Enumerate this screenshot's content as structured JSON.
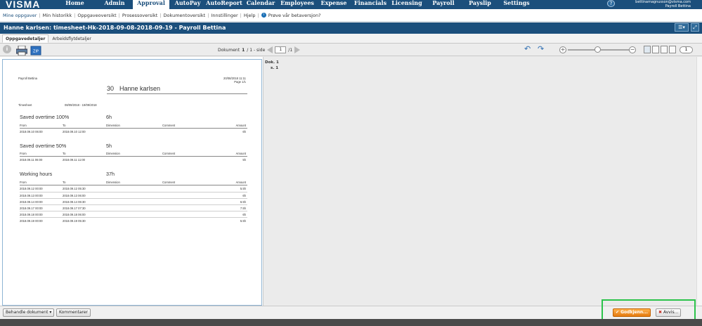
{
  "brand": {
    "logo_text": "VISMA"
  },
  "nav": {
    "items": [
      {
        "label": "Home"
      },
      {
        "label": "Admin"
      },
      {
        "label": "Approval"
      },
      {
        "label": "AutoPay"
      },
      {
        "label": "AutoReport"
      },
      {
        "label": "Calendar"
      },
      {
        "label": "Employees"
      },
      {
        "label": "Expense"
      },
      {
        "label": "Financials"
      },
      {
        "label": "Licensing"
      },
      {
        "label": "Payroll"
      },
      {
        "label": "Payslip"
      },
      {
        "label": "Settings"
      }
    ],
    "active": "Approval"
  },
  "account": {
    "email": "bettinamagnusson@visma.com",
    "company": "Payroll Bettina"
  },
  "subnav": {
    "items": [
      "Mine oppgaver",
      "Min historikk",
      "Oppgaveoversikt",
      "Prosessoversikt",
      "Dokumentoversikt",
      "Innstillinger",
      "Hjelp"
    ],
    "beta_link": "Prøve vår betaversjon?"
  },
  "page_title": "Hanne karlsen: timesheet-Hk-2018-09-08-2018-09-19 - Payroll Bettina",
  "tabs": [
    "Oppgavedetaljer",
    "Arbeidsflytdetaljer"
  ],
  "toolbar": {
    "doc_label": "Dokument",
    "doc_num": "1",
    "doc_of": "/ 1 - side",
    "page_input": "1",
    "page_total": "/1",
    "page_count_badge": "1"
  },
  "document": {
    "company": "Payroll Bettina",
    "print_date": "20/08/2018 11:11",
    "page_info": "Page 1/1",
    "emp_number": "30",
    "emp_name": "Hanne karlsen",
    "doc_type": "Timesheet",
    "period": "08/09/2018 - 19/09/2018",
    "col_from": "From",
    "col_to": "To",
    "col_dimension": "Dimension",
    "col_comment": "Comment",
    "col_amount": "Amount",
    "sections": [
      {
        "title": "Saved overtime 100%",
        "total": "6h",
        "rows": [
          {
            "from": "2018.09.10 06:00",
            "to": "2018.09.10 12:00",
            "amount": "6h"
          }
        ]
      },
      {
        "title": "Saved overtime 50%",
        "total": "5h",
        "rows": [
          {
            "from": "2018.09.11 06:00",
            "to": "2018.09.11 11:00",
            "amount": "5h"
          }
        ]
      },
      {
        "title": "Working hours",
        "total": "37h",
        "rows": [
          {
            "from": "2018.09.12 00:00",
            "to": "2018.09.12 05:30",
            "amount": "5.5h"
          },
          {
            "from": "2018.09.13 00:00",
            "to": "2018.09.13 06:00",
            "amount": "6h"
          },
          {
            "from": "2018.09.14 00:00",
            "to": "2018.09.14 06:30",
            "amount": "6.5h"
          },
          {
            "from": "2018.09.17 00:00",
            "to": "2018.09.17 07:30",
            "amount": "7.5h"
          },
          {
            "from": "2018.09.18 00:00",
            "to": "2018.09.18 06:00",
            "amount": "6h"
          },
          {
            "from": "2018.09.19 00:00",
            "to": "2018.09.19 05:30",
            "amount": "5.5h"
          }
        ]
      }
    ]
  },
  "thumbs": {
    "doc_label": "Dok. 1",
    "page_label": "s. 1"
  },
  "bottom": {
    "process_doc": "Behandle dokument",
    "comments": "Kommentarer",
    "approve": "Godkjenn...",
    "reject": "Avvis..."
  },
  "colors": {
    "brand_blue": "#1b4f7c",
    "approve_orange": "#e57b10",
    "highlight_green": "#2cc34b"
  }
}
